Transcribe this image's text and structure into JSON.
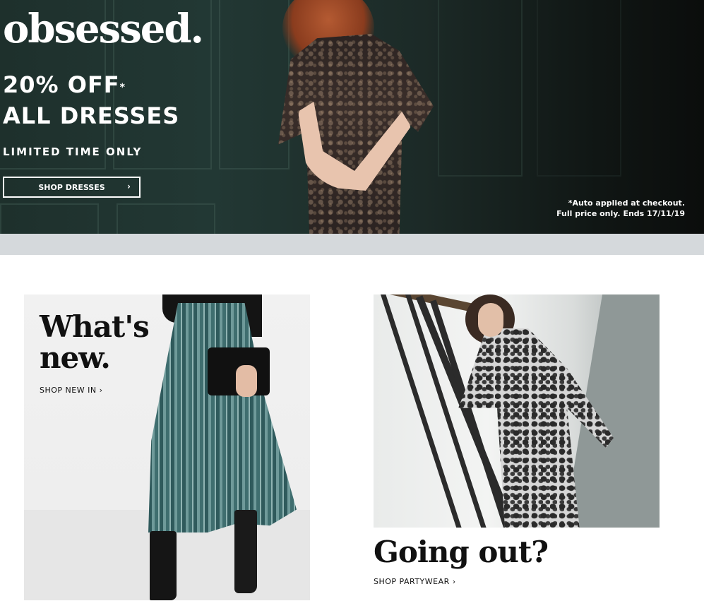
{
  "hero": {
    "logo": "obsessed.",
    "offer_line1": "20% OFF",
    "offer_star": "*",
    "offer_line2": "ALL DRESSES",
    "subtitle": "LIMITED TIME ONLY",
    "button_label": "SHOP DRESSES",
    "button_chevron": "›",
    "note_line1": "*Auto applied at checkout.",
    "note_line2": "Full price only. Ends 17/11/19"
  },
  "cards": [
    {
      "title_line1": "What's",
      "title_line2": "new.",
      "link_label": "SHOP NEW IN ›"
    },
    {
      "title": "Going out?",
      "link_label": "SHOP PARTYWEAR ›"
    }
  ],
  "colors": {
    "hero_bg": "#1e302c",
    "strip": "#d5d9dc",
    "text_dark": "#111111",
    "text_light": "#ffffff"
  }
}
